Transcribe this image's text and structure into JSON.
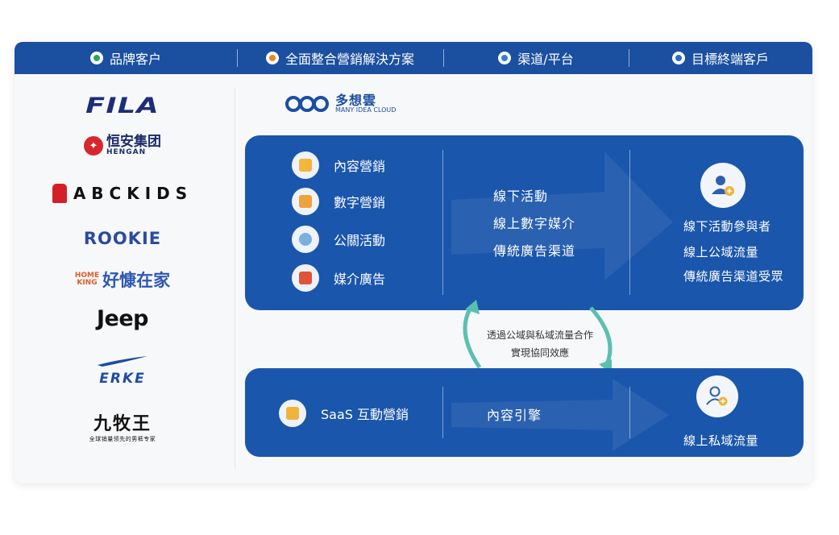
{
  "header": {
    "col1": "品牌客户",
    "col2": "全面整合營銷解決方案",
    "col3": "渠道/平台",
    "col4": "目標終端客戶"
  },
  "brands": {
    "fila": "FILA",
    "hengan_cn": "恒安集团",
    "hengan_en": "HENGAN",
    "abckids": "ABCKIDS",
    "rookie": "ROOKIE",
    "homeking_en1": "HOME",
    "homeking_en2": "KING",
    "homeking_cn": "好慷在家",
    "jeep": "Jeep",
    "erke": "ERKE",
    "jiumu_cn": "九牧王",
    "jiumu_sub": "全球销量领先的男裤专家"
  },
  "company": {
    "name_cn": "多想雲",
    "name_en": "MANY IDEA CLOUD"
  },
  "panel1": {
    "solutions": [
      "內容營銷",
      "數字營銷",
      "公關活動",
      "媒介廣告"
    ],
    "channels": [
      "線下活動",
      "線上數字媒介",
      "傳統廣告渠道"
    ],
    "targets": [
      "線下活動參與者",
      "線上公域流量",
      "傳統廣告渠道受眾"
    ]
  },
  "middle": {
    "line1": "透過公域與私域流量合作",
    "line2": "實現協同效應"
  },
  "panel2": {
    "solution": "SaaS 互動營銷",
    "channel": "內容引擎",
    "target": "線上私域流量"
  },
  "colors": {
    "header_blue": "#1b4fa0",
    "panel_blue": "#1a56ac",
    "arrow_teal": "#5bbfb0"
  }
}
